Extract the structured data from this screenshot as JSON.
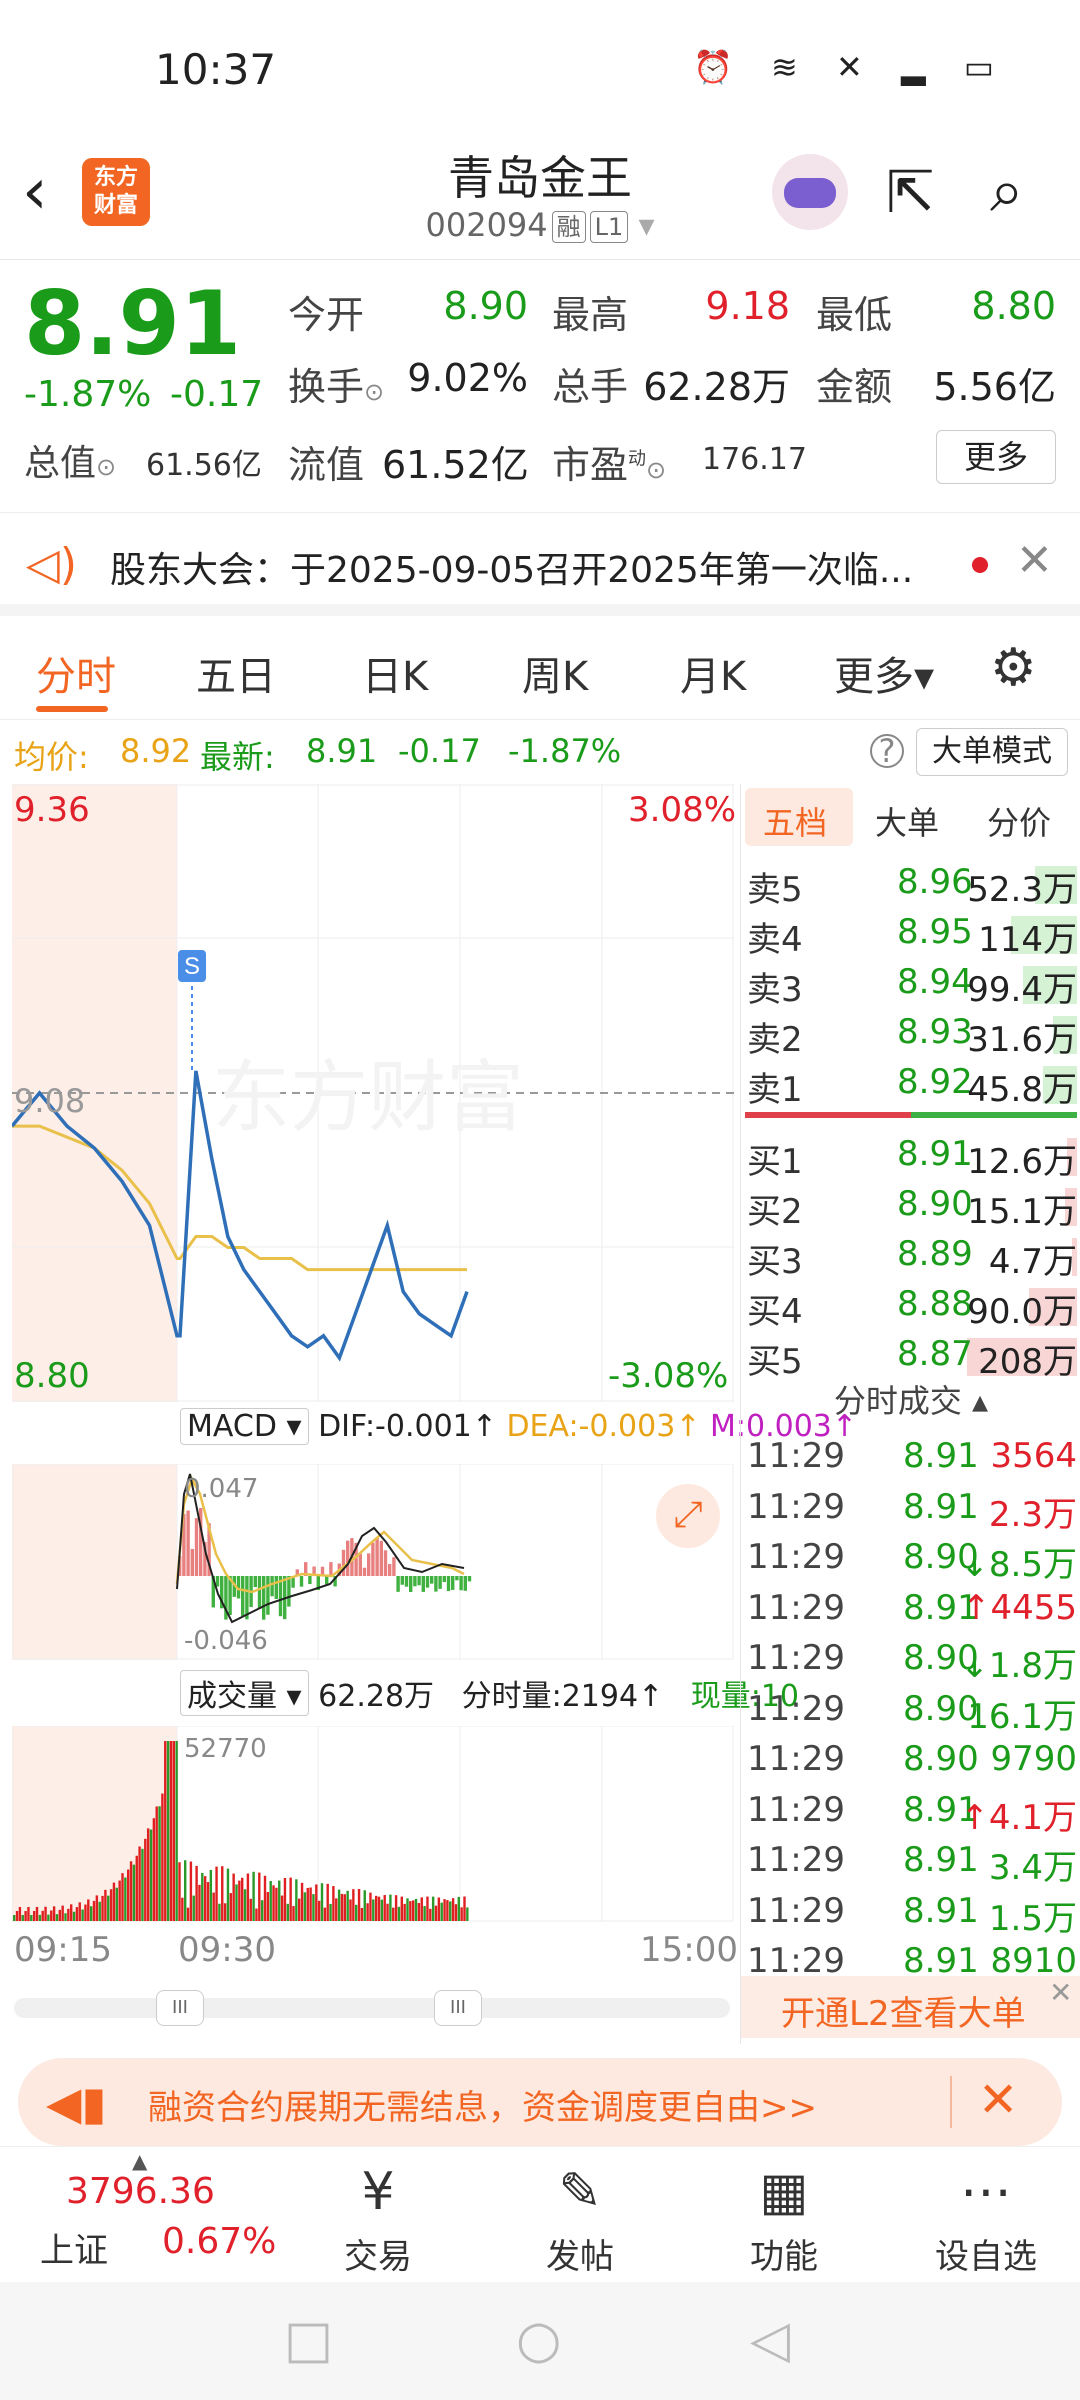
{
  "status_bar": {
    "time": "10:37",
    "icons": "⏰ ≋ ✕ ▂ ▭"
  },
  "header": {
    "back_icon": "‹",
    "logo_text_1": "东方",
    "logo_text_2": "财富",
    "stock_name": "青岛金王",
    "stock_code": "002094",
    "tag_margin": "融",
    "tag_level": "L1",
    "dropdown_icon": "▾",
    "share_icon": "⇱",
    "search_icon": "⌕"
  },
  "quote": {
    "price": "8.91",
    "change_pct": "-1.87%",
    "change_amt": "-0.17",
    "open_label": "今开",
    "open": "8.90",
    "high_label": "最高",
    "high": "9.18",
    "low_label": "最低",
    "low": "8.80",
    "turnover_label": "换手",
    "turnover": "9.02%",
    "volume_label": "总手",
    "volume": "62.28万",
    "amount_label": "金额",
    "amount": "5.56亿",
    "mktcap_label": "总值",
    "mktcap": "61.56亿",
    "float_label": "流值",
    "float": "61.52亿",
    "pe_label": "市盈",
    "pe_sup": "动",
    "pe": "176.17",
    "more": "更多"
  },
  "notice": {
    "icon": "🔊",
    "text": "股东大会：于2025-09-05召开2025年第一次临...",
    "close": "✕"
  },
  "tabs": [
    "分时",
    "五日",
    "日K",
    "周K",
    "月K",
    "更多▾"
  ],
  "gear_icon": "⚙",
  "avg_row": {
    "avg_label": "均价:",
    "avg": "8.92",
    "latest_label": "最新:",
    "latest": "8.91",
    "chg": "-0.17",
    "pct": "-1.87%",
    "help": "?",
    "big_order_mode": "大单模式"
  },
  "chart": {
    "price_high": "9.36",
    "price_low": "8.80",
    "price_mid": "9.08",
    "pct_high": "3.08%",
    "pct_low": "-3.08%",
    "marker": "S",
    "watermark": "东方财富",
    "macd_sel": "MACD ▾",
    "dif": "DIF:-0.001↑",
    "dea": "DEA:-0.003↑",
    "m": "M:0.003↑",
    "macd_top": "0.047",
    "macd_bot": "-0.046",
    "expand_icon": "⤢",
    "vol_sel": "成交量 ▾",
    "vol_total": "62.28万",
    "vol_now": "分时量:2194↑",
    "vol_cur": "现量:10",
    "vol_max": "52770",
    "time_start": "09:15",
    "time_mid": "09:30",
    "time_end": "15:00",
    "handle": "III"
  },
  "chart_data": {
    "type": "line",
    "title": "",
    "ylim": [
      8.8,
      9.36
    ],
    "x_ticks": [
      "09:15",
      "09:30",
      "15:00"
    ],
    "series": [
      {
        "values": [
          9.05,
          9.08,
          9.05,
          9.03,
          9.0,
          8.96,
          8.86,
          9.1,
          9.02,
          8.95,
          8.92,
          8.9,
          8.88,
          8.86,
          8.85,
          8.86,
          8.84,
          8.88,
          8.92,
          8.96,
          8.9,
          8.88,
          8.87,
          8.86,
          8.9
        ]
      },
      {
        "values": [
          9.05,
          9.05,
          9.04,
          9.03,
          9.01,
          8.98,
          8.93,
          8.95,
          8.95,
          8.94,
          8.94,
          8.93,
          8.93,
          8.93,
          8.92,
          8.92,
          8.92,
          8.92,
          8.92,
          8.92,
          8.92,
          8.92,
          8.92,
          8.92,
          8.92
        ]
      }
    ]
  },
  "book": {
    "tabs": [
      "五档",
      "大单",
      "分价"
    ],
    "sells": [
      {
        "label": "卖5",
        "price": "8.96",
        "vol": "52.3万",
        "bar": 0.35
      },
      {
        "label": "卖4",
        "price": "8.95",
        "vol": "114万",
        "bar": 0.55
      },
      {
        "label": "卖3",
        "price": "8.94",
        "vol": "99.4万",
        "bar": 0.45
      },
      {
        "label": "卖2",
        "price": "8.93",
        "vol": "31.6万",
        "bar": 0.2
      },
      {
        "label": "卖1",
        "price": "8.92",
        "vol": "45.8万",
        "bar": 0.28
      }
    ],
    "buys": [
      {
        "label": "买1",
        "price": "8.91",
        "vol": "12.6万",
        "bar": 0.08
      },
      {
        "label": "买2",
        "price": "8.90",
        "vol": "15.1万",
        "bar": 0.1
      },
      {
        "label": "买3",
        "price": "8.89",
        "vol": "4.7万",
        "bar": 0.04
      },
      {
        "label": "买4",
        "price": "8.88",
        "vol": "90.0万",
        "bar": 0.4
      },
      {
        "label": "买5",
        "price": "8.87",
        "vol": "208万",
        "bar": 0.92
      }
    ],
    "trades_head": "分时成交 ▴",
    "trades": [
      {
        "time": "11:29",
        "price": "8.91",
        "vol": "3564",
        "color": "#e0202a"
      },
      {
        "time": "11:29",
        "price": "8.91",
        "vol": "2.3万",
        "color": "#e0202a"
      },
      {
        "time": "11:29",
        "price": "8.90",
        "vol": "↓8.5万",
        "color": "#1a9b1a"
      },
      {
        "time": "11:29",
        "price": "8.91",
        "vol": "↑4455",
        "color": "#e0202a"
      },
      {
        "time": "11:29",
        "price": "8.90",
        "vol": "↓1.8万",
        "color": "#1a9b1a"
      },
      {
        "time": "11:29",
        "price": "8.90",
        "vol": "16.1万",
        "color": "#1a9b1a"
      },
      {
        "time": "11:29",
        "price": "8.90",
        "vol": "9790",
        "color": "#1a9b1a"
      },
      {
        "time": "11:29",
        "price": "8.91",
        "vol": "↑4.1万",
        "color": "#e0202a"
      },
      {
        "time": "11:29",
        "price": "8.91",
        "vol": "3.4万",
        "color": "#1a9b1a"
      },
      {
        "time": "11:29",
        "price": "8.91",
        "vol": "1.5万",
        "color": "#1a9b1a"
      },
      {
        "time": "11:29",
        "price": "8.91",
        "vol": "8910",
        "color": "#1a9b1a"
      }
    ],
    "l2_text": "开通L2查看大单",
    "l2_close": "✕"
  },
  "promo": {
    "icon": "📢",
    "text": "融资合约展期无需结息，资金调度更自由>>",
    "close": "✕"
  },
  "bottom_nav": {
    "index_value": "3796.36",
    "index_name": "上证",
    "index_pct": "0.67%",
    "items": [
      {
        "icon": "¥",
        "label": "交易"
      },
      {
        "icon": "✎",
        "label": "发帖"
      },
      {
        "icon": "▦",
        "label": "功能"
      },
      {
        "icon": "⋯",
        "label": "设自选"
      }
    ]
  },
  "system_nav": {
    "recent": "□",
    "home": "○",
    "back": "◁"
  }
}
